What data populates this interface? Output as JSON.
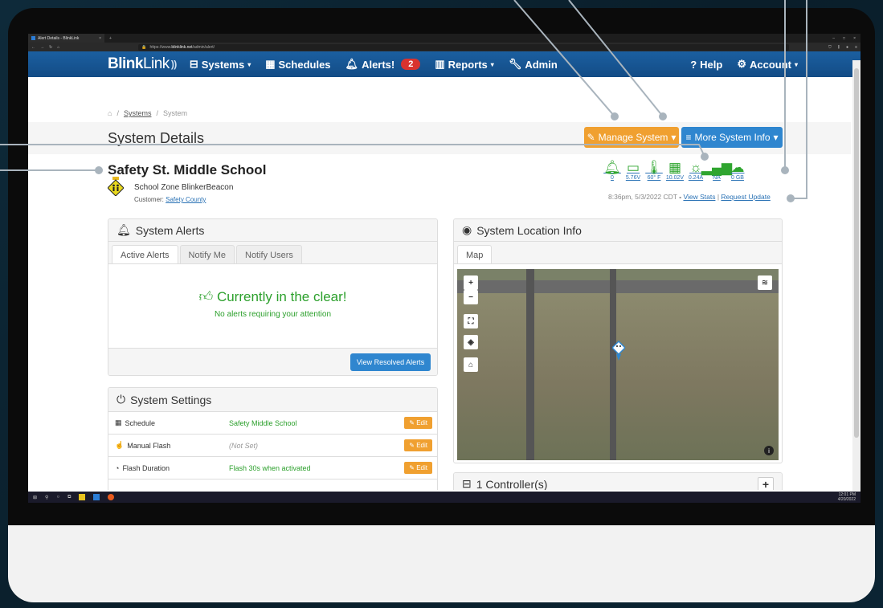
{
  "browser": {
    "tab_title": "Alert Details - BlinkLink",
    "tab_close": "×",
    "tab_new": "+",
    "url_prefix": "https://www.",
    "url_host": "blinklink.net",
    "url_path": "/admin/alert/",
    "window_controls": [
      "–",
      "□",
      "×"
    ]
  },
  "navbar": {
    "brand_bold": "Blink",
    "brand_light": "Link",
    "brand_mark": "))",
    "systems": "Systems",
    "schedules": "Schedules",
    "alerts": "Alerts!",
    "alerts_count": "2",
    "reports": "Reports",
    "admin": "Admin",
    "help": "Help",
    "account": "Account"
  },
  "breadcrumb": {
    "home_icon": "home-icon",
    "sep": "/",
    "systems": "Systems",
    "current": "System"
  },
  "header": {
    "title": "System Details",
    "manage_btn": "Manage System",
    "more_info_btn": "More System Info"
  },
  "system": {
    "name": "Safety St. Middle School",
    "type": "School Zone BlinkerBeacon",
    "customer_label": "Customer:",
    "customer": "Safety County"
  },
  "status": {
    "items": [
      {
        "icon": "bell-icon",
        "value": "0"
      },
      {
        "icon": "battery-icon",
        "value": "5.76V"
      },
      {
        "icon": "thermometer-icon",
        "value": "60° F"
      },
      {
        "icon": "solar-panel-icon",
        "value": "10.02V"
      },
      {
        "icon": "sun-icon",
        "value": "0.24A"
      },
      {
        "icon": "signal-icon",
        "value": "NA"
      },
      {
        "icon": "cloud-download-icon",
        "value": "0 GB"
      }
    ],
    "timestamp": "8:36pm, 5/3/2022 CDT",
    "dash": "-",
    "view_stats": "View Stats",
    "pipe": "|",
    "request_update": "Request Update",
    "accent": "#2fa52f"
  },
  "alerts_panel": {
    "title": "System Alerts",
    "tabs": [
      "Active Alerts",
      "Notify Me",
      "Notify Users"
    ],
    "message": "Currently in the clear!",
    "sub": "No alerts requiring your attention",
    "resolved_btn": "View Resolved Alerts"
  },
  "settings_panel": {
    "title": "System Settings",
    "rows": [
      {
        "label": "Schedule",
        "value": "Safety Middle School",
        "edit": "Edit"
      },
      {
        "label": "Manual Flash",
        "value": "(Not Set)",
        "edit": "Edit"
      },
      {
        "label": "Flash Duration",
        "value": "Flash 30s when activated",
        "edit": "Edit"
      }
    ]
  },
  "location_panel": {
    "title": "System Location Info",
    "tab": "Map",
    "zoom_in": "+",
    "zoom_out": "−"
  },
  "controllers_panel": {
    "title": "1 Controller(s)",
    "add": "+"
  },
  "taskbar": {
    "time": "12:01 PM",
    "date": "4/20/2022"
  },
  "colors": {
    "navbar": "#1b5fa0",
    "orange": "#f0a030",
    "blue": "#2f86cf",
    "green": "#2fa52f",
    "badge": "#d9332f"
  }
}
